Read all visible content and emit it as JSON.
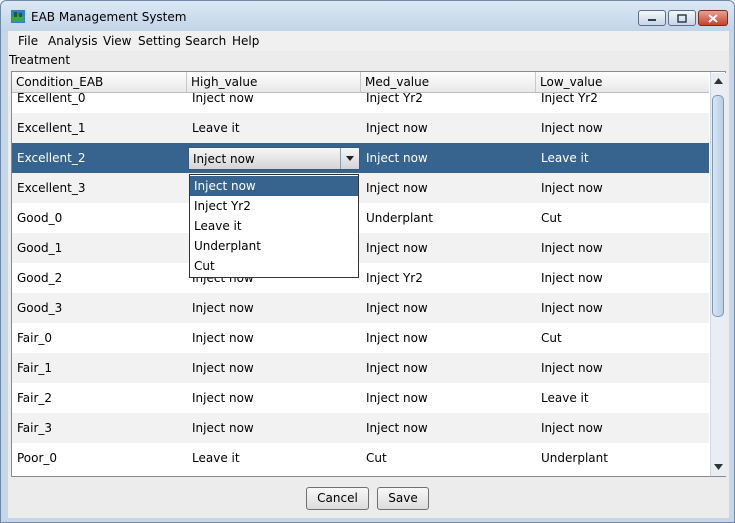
{
  "window": {
    "title": "EAB Management System"
  },
  "menu": [
    "File",
    "Analysis",
    "View",
    "Setting",
    "Search",
    "Help"
  ],
  "group_label": "Treatment",
  "table": {
    "columns": [
      "Condition_EAB",
      "High_value",
      "Med_value",
      "Low_value"
    ],
    "rows": [
      [
        "Excellent_0",
        "Inject now",
        "Inject Yr2",
        "Inject Yr2"
      ],
      [
        "Excellent_1",
        "Leave it",
        "Inject now",
        "Inject now"
      ],
      [
        "Excellent_2",
        "Inject now",
        "Inject now",
        "Leave it"
      ],
      [
        "Excellent_3",
        "Inject now",
        "Inject now",
        "Inject now"
      ],
      [
        "Good_0",
        "",
        "Underplant",
        "Cut"
      ],
      [
        "Good_1",
        "",
        "Inject now",
        "Inject now"
      ],
      [
        "Good_2",
        "Inject now",
        "Inject Yr2",
        "Inject now"
      ],
      [
        "Good_3",
        "Inject now",
        "Inject now",
        "Inject now"
      ],
      [
        "Fair_0",
        "Inject now",
        "Inject now",
        "Cut"
      ],
      [
        "Fair_1",
        "Inject now",
        "Inject now",
        "Inject now"
      ],
      [
        "Fair_2",
        "Inject now",
        "Inject now",
        "Leave it"
      ],
      [
        "Fair_3",
        "Inject now",
        "Inject now",
        "Inject now"
      ],
      [
        "Poor_0",
        "Leave it",
        "Cut",
        "Underplant"
      ]
    ],
    "selected_row": 2,
    "editor": {
      "value": "Inject now",
      "options": [
        "Inject now",
        "Inject Yr2",
        "Leave it",
        "Underplant",
        "Cut"
      ],
      "highlighted": 0
    }
  },
  "buttons": {
    "cancel": "Cancel",
    "save": "Save"
  },
  "colors": {
    "selection": "#36648e",
    "close_button": "#c7402a"
  }
}
